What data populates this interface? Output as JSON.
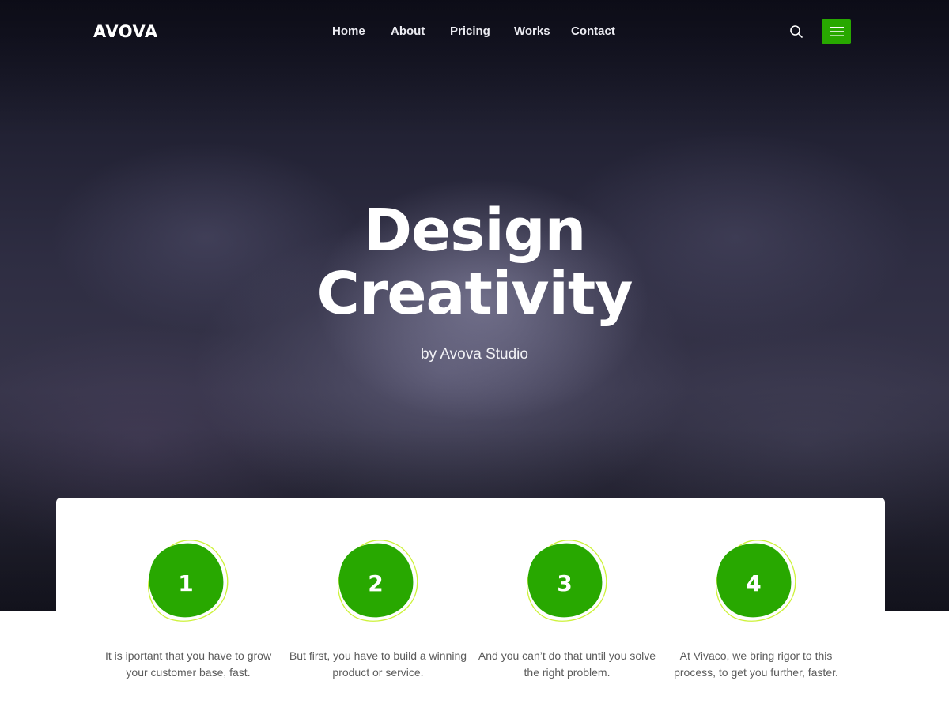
{
  "brand": {
    "logo": "AVOVA"
  },
  "nav": {
    "items": [
      {
        "label": "Home"
      },
      {
        "label": "About"
      },
      {
        "label": "Pricing"
      },
      {
        "label": "Works"
      },
      {
        "label": "Contact"
      }
    ],
    "search_icon": "search-icon",
    "menu_icon": "hamburger-menu-icon"
  },
  "hero": {
    "title_line1": "Design",
    "title_line2": "Creativity",
    "subtitle": "by Avova Studio"
  },
  "features": [
    {
      "number": "1",
      "text": "It is iportant that you have to grow your customer base, fast."
    },
    {
      "number": "2",
      "text": "But first, you have to build a winning product or service."
    },
    {
      "number": "3",
      "text": "And you can’t do that until you solve the right problem."
    },
    {
      "number": "4",
      "text": "At Vivaco, we bring rigor to this process, to get you further, faster."
    }
  ],
  "colors": {
    "accent": "#28a800",
    "accent_ring": "#cdf23a",
    "text_muted": "#5c5c5c"
  }
}
